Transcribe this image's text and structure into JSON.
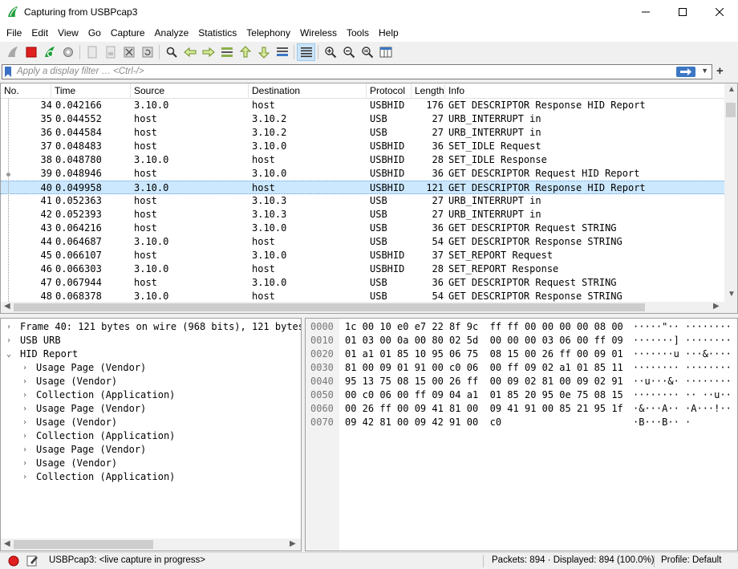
{
  "window": {
    "title": "Capturing from USBPcap3",
    "minimize": "—",
    "maximize": "☐",
    "close": "✕"
  },
  "menu": [
    "File",
    "Edit",
    "View",
    "Go",
    "Capture",
    "Analyze",
    "Statistics",
    "Telephony",
    "Wireless",
    "Tools",
    "Help"
  ],
  "filter": {
    "placeholder": "Apply a display filter … <Ctrl-/>",
    "plus": "+"
  },
  "packet_list": {
    "columns": [
      "No.",
      "Time",
      "Source",
      "Destination",
      "Protocol",
      "Length",
      "Info"
    ],
    "rows": [
      {
        "no": "34",
        "time": "0.042166",
        "src": "3.10.0",
        "dst": "host",
        "proto": "USBHID",
        "len": "176",
        "info": "GET DESCRIPTOR Response HID Report"
      },
      {
        "no": "35",
        "time": "0.044552",
        "src": "host",
        "dst": "3.10.2",
        "proto": "USB",
        "len": "27",
        "info": "URB_INTERRUPT in"
      },
      {
        "no": "36",
        "time": "0.044584",
        "src": "host",
        "dst": "3.10.2",
        "proto": "USB",
        "len": "27",
        "info": "URB_INTERRUPT in"
      },
      {
        "no": "37",
        "time": "0.048483",
        "src": "host",
        "dst": "3.10.0",
        "proto": "USBHID",
        "len": "36",
        "info": "SET_IDLE Request"
      },
      {
        "no": "38",
        "time": "0.048780",
        "src": "3.10.0",
        "dst": "host",
        "proto": "USBHID",
        "len": "28",
        "info": "SET_IDLE Response"
      },
      {
        "no": "39",
        "time": "0.048946",
        "src": "host",
        "dst": "3.10.0",
        "proto": "USBHID",
        "len": "36",
        "info": "GET DESCRIPTOR Request HID Report"
      },
      {
        "no": "40",
        "time": "0.049958",
        "src": "3.10.0",
        "dst": "host",
        "proto": "USBHID",
        "len": "121",
        "info": "GET DESCRIPTOR Response HID Report",
        "selected": true
      },
      {
        "no": "41",
        "time": "0.052363",
        "src": "host",
        "dst": "3.10.3",
        "proto": "USB",
        "len": "27",
        "info": "URB_INTERRUPT in"
      },
      {
        "no": "42",
        "time": "0.052393",
        "src": "host",
        "dst": "3.10.3",
        "proto": "USB",
        "len": "27",
        "info": "URB_INTERRUPT in"
      },
      {
        "no": "43",
        "time": "0.064216",
        "src": "host",
        "dst": "3.10.0",
        "proto": "USB",
        "len": "36",
        "info": "GET DESCRIPTOR Request STRING"
      },
      {
        "no": "44",
        "time": "0.064687",
        "src": "3.10.0",
        "dst": "host",
        "proto": "USB",
        "len": "54",
        "info": "GET DESCRIPTOR Response STRING"
      },
      {
        "no": "45",
        "time": "0.066107",
        "src": "host",
        "dst": "3.10.0",
        "proto": "USBHID",
        "len": "37",
        "info": "SET_REPORT Request"
      },
      {
        "no": "46",
        "time": "0.066303",
        "src": "3.10.0",
        "dst": "host",
        "proto": "USBHID",
        "len": "28",
        "info": "SET_REPORT Response"
      },
      {
        "no": "47",
        "time": "0.067944",
        "src": "host",
        "dst": "3.10.0",
        "proto": "USB",
        "len": "36",
        "info": "GET DESCRIPTOR Request STRING"
      },
      {
        "no": "48",
        "time": "0.068378",
        "src": "3.10.0",
        "dst": "host",
        "proto": "USB",
        "len": "54",
        "info": "GET DESCRIPTOR Response STRING"
      }
    ]
  },
  "detail": {
    "rows": [
      {
        "text": "Frame 40: 121 bytes on wire (968 bits), 121 bytes",
        "chevron": "›",
        "level": 0
      },
      {
        "text": "USB URB",
        "chevron": "›",
        "level": 0
      },
      {
        "text": "HID Report",
        "chevron": "⌄",
        "level": 0
      },
      {
        "text": "Usage Page (Vendor)",
        "chevron": "›",
        "level": 1
      },
      {
        "text": "Usage (Vendor)",
        "chevron": "›",
        "level": 1
      },
      {
        "text": "Collection (Application)",
        "chevron": "›",
        "level": 1
      },
      {
        "text": "Usage Page (Vendor)",
        "chevron": "›",
        "level": 1
      },
      {
        "text": "Usage (Vendor)",
        "chevron": "›",
        "level": 1
      },
      {
        "text": "Collection (Application)",
        "chevron": "›",
        "level": 1
      },
      {
        "text": "Usage Page (Vendor)",
        "chevron": "›",
        "level": 1
      },
      {
        "text": "Usage (Vendor)",
        "chevron": "›",
        "level": 1
      },
      {
        "text": "Collection (Application)",
        "chevron": "›",
        "level": 1
      }
    ]
  },
  "bytes": {
    "rows": [
      {
        "off": "0000",
        "hex": "1c 00 10 e0 e7 22 8f 9c  ff ff 00 00 00 00 08 00",
        "ascii": "·····\"·· ········"
      },
      {
        "off": "0010",
        "hex": "01 03 00 0a 00 80 02 5d  00 00 00 03 06 00 ff 09",
        "ascii": "·······] ········"
      },
      {
        "off": "0020",
        "hex": "01 a1 01 85 10 95 06 75  08 15 00 26 ff 00 09 01",
        "ascii": "·······u ···&····"
      },
      {
        "off": "0030",
        "hex": "81 00 09 01 91 00 c0 06  00 ff 09 02 a1 01 85 11",
        "ascii": "········ ········"
      },
      {
        "off": "0040",
        "hex": "95 13 75 08 15 00 26 ff  00 09 02 81 00 09 02 91",
        "ascii": "··u···&· ········"
      },
      {
        "off": "0050",
        "hex": "00 c0 06 00 ff 09 04 a1  01 85 20 95 0e 75 08 15",
        "ascii": "········ ·· ··u··"
      },
      {
        "off": "0060",
        "hex": "00 26 ff 00 09 41 81 00  09 41 91 00 85 21 95 1f",
        "ascii": "·&···A·· ·A···!··"
      },
      {
        "off": "0070",
        "hex": "09 42 81 00 09 42 91 00  c0",
        "ascii": "·B···B·· ·"
      }
    ]
  },
  "status": {
    "capture_text": "USBPcap3: <live capture in progress>",
    "packets_text": "Packets: 894 · Displayed: 894 (100.0%)",
    "profile_text": "Profile: Default"
  },
  "colors": {
    "selected_row": "#cce8ff",
    "stop_red": "#e02020",
    "wireshark_green": "#1e9e3a",
    "filter_arrow": "#3b77c4"
  }
}
